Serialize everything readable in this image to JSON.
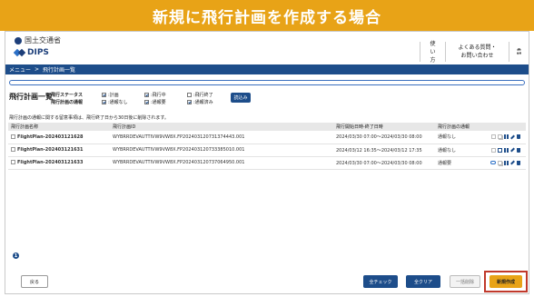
{
  "banner": {
    "title": "新規に飛行計画を作成する場合"
  },
  "header": {
    "ministry": "国土交通省",
    "logo": "DIPS",
    "usage_link": "使い方",
    "faq_line1": "よくある質問・",
    "faq_line2": "お問い合わせ",
    "settings_icon": "gear-icon"
  },
  "menubar": {
    "menu": "メニュー",
    "separator": ">",
    "current": "飛行計画一覧"
  },
  "page": {
    "title": "飛行計画一覧"
  },
  "filters": {
    "status_label": "飛行ステータス",
    "report_label": "飛行計画の通報",
    "status_options": [
      {
        "label": ":計画",
        "checked": true
      },
      {
        "label": ":飛行中",
        "checked": true
      },
      {
        "label": ":飛行終了",
        "checked": false
      }
    ],
    "report_options": [
      {
        "label": ":通報なし",
        "checked": true
      },
      {
        "label": ":通報要",
        "checked": true
      },
      {
        "label": ":通報済み",
        "checked": true
      }
    ],
    "load_button": "読込み"
  },
  "note": "飛行計画の通報に関する留意事項は、飛行終了日から30日後に削除されます。",
  "table": {
    "headers": [
      "飛行計画名称",
      "飛行計画ID",
      "飛行開始日時-終了日時",
      "飛行計画の通報",
      ""
    ],
    "rows": [
      {
        "name": "FlightPlan-202403121628",
        "id": "WYBRRDEVAUTTIVW9VW8X.FP202403120731374443.001",
        "period": "2024/03/30 07:00～2024/03/30 08:00",
        "report": "通報なし"
      },
      {
        "name": "FlightPlan-202403121631",
        "id": "WYBRRDEVAUTTIVW9VW8X.FP202403120733385010.001",
        "period": "2024/03/12 16:35～2024/03/12 17:35",
        "report": "通報なし"
      },
      {
        "name": "FlightPlan-202403121633",
        "id": "WYBRRDEVAUTTIVW9VW8X.FP202403120737064950.001",
        "period": "2024/03/30 07:00～2024/03/30 08:00",
        "report": "通報要"
      }
    ]
  },
  "info": {
    "count": "1"
  },
  "footer": {
    "back": "戻る",
    "check_all": "全チェック",
    "clear_all": "全クリア",
    "bulk_delete": "一括削除",
    "new_create": "新規作成"
  },
  "colors": {
    "accent": "#e8a317",
    "primary": "#1d4d8a",
    "highlight": "#c0392b"
  }
}
